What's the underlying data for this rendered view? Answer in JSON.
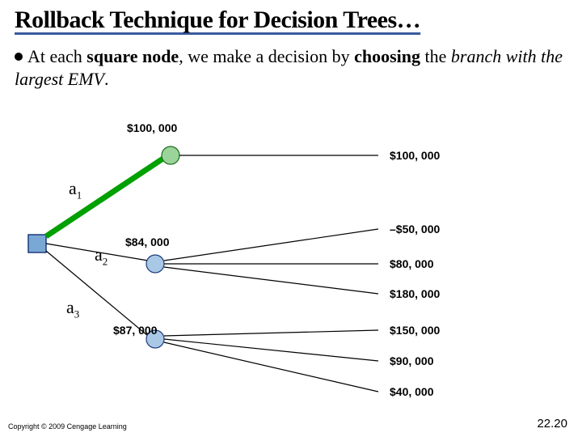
{
  "title": "Rollback Technique for Decision Trees…",
  "body_prefix": "At each ",
  "body_b1": "square node",
  "body_mid": ", we make a decision by ",
  "body_b2": "choosing",
  "body_suffix": " the ",
  "body_ital": "branch with the largest EMV",
  "body_end": ".",
  "tree": {
    "a1": {
      "label": "a",
      "sub": "1",
      "value": "$100, 000",
      "outcome": "$100, 000"
    },
    "a2": {
      "label": "a",
      "sub": "2",
      "value": "$84, 000",
      "outcomes": [
        "–$50, 000",
        "$80, 000",
        "$180, 000"
      ]
    },
    "a3": {
      "label": "a",
      "sub": "3",
      "value": "$87, 000",
      "outcomes": [
        "$150, 000",
        "$90, 000",
        "$40, 000"
      ]
    }
  },
  "footer": {
    "copyright": "Copyright © 2009 Cengage Learning",
    "slide_num": "22.20"
  }
}
